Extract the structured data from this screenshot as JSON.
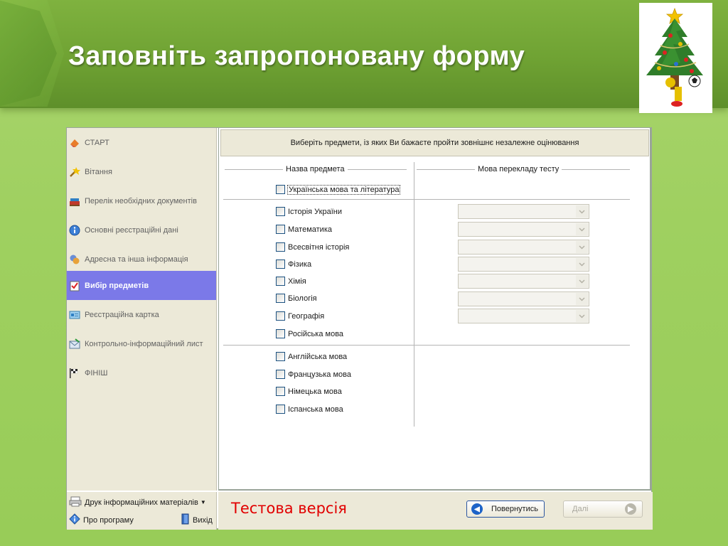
{
  "slide": {
    "title": "Заповніть запропоновану форму"
  },
  "sidebar": {
    "items": [
      {
        "label": "СТАРТ",
        "icon": "start-icon"
      },
      {
        "label": "Вітання",
        "icon": "greeting-icon"
      },
      {
        "label": "Перелік необхідних документів",
        "icon": "books-icon"
      },
      {
        "label": "Основні реєстраційні дані",
        "icon": "info-icon"
      },
      {
        "label": "Адресна та інша інформація",
        "icon": "address-icon"
      },
      {
        "label": "Вибір предметів",
        "icon": "checklist-icon",
        "active": true
      },
      {
        "label": "Реєстраційна картка",
        "icon": "card-icon"
      },
      {
        "label": "Контрольно-інформаційний лист",
        "icon": "envelope-icon"
      },
      {
        "label": "ФІНІШ",
        "icon": "finish-flag-icon"
      }
    ],
    "print_label": "Друк інформаційних матеріалів",
    "about_label": "Про програму",
    "exit_label": "Вихід"
  },
  "main": {
    "instruction": "Виберіть предмети, із яких Ви бажаєте пройти зовнішнє незалежне оцінювання",
    "col_subject": "Назва предмета",
    "col_language": "Мова перекладу тесту",
    "group1": [
      "Українська мова та література"
    ],
    "group2": [
      "Історія України",
      "Математика",
      "Всесвітня історія",
      "Фізика",
      "Хімія",
      "Біологія",
      "Географія",
      "Російська мова"
    ],
    "group3": [
      "Англійська мова",
      "Французька мова",
      "Німецька мова",
      "Іспанська мова"
    ]
  },
  "footer": {
    "test_version": "Тестова версія",
    "back_label": "Повернутись",
    "next_label": "Далі"
  },
  "colors": {
    "accent": "#7b79e8",
    "header_green": "#6fa233",
    "test_red": "#e10000"
  }
}
